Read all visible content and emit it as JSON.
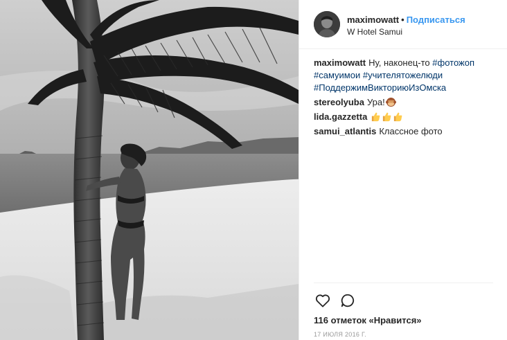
{
  "post": {
    "author": {
      "username": "maximowatt",
      "separator": "•",
      "follow_label": "Подписаться",
      "location": "W Hotel Samui"
    },
    "caption": {
      "username": "maximowatt",
      "text": "Ну, наконец-то",
      "hashtags": [
        "#фотожоп",
        "#самуимои",
        "#учителятожелюди",
        "#ПоддержимВикториюИзОмска"
      ]
    },
    "comments": [
      {
        "username": "stereolyuba",
        "text": "Ура!",
        "emoji": "see-no-evil-monkey-emoji"
      },
      {
        "username": "lida.gazzetta",
        "text": "",
        "emoji": "thumbs-up-emoji-x3"
      },
      {
        "username": "samui_atlantis",
        "text": "Классное фото",
        "emoji": ""
      }
    ],
    "actions": {
      "like_icon": "heart-outline-icon",
      "comment_icon": "speech-bubble-icon"
    },
    "likes_text": "116 отметок «Нравится»",
    "date": "17 ИЮЛЯ 2016 Г."
  },
  "photo": {
    "description_icon": "beach-palm-photo"
  },
  "colors": {
    "link_blue": "#3897f0",
    "hashtag": "#003569",
    "text": "#262626",
    "muted": "#999999",
    "border": "#efefef"
  }
}
